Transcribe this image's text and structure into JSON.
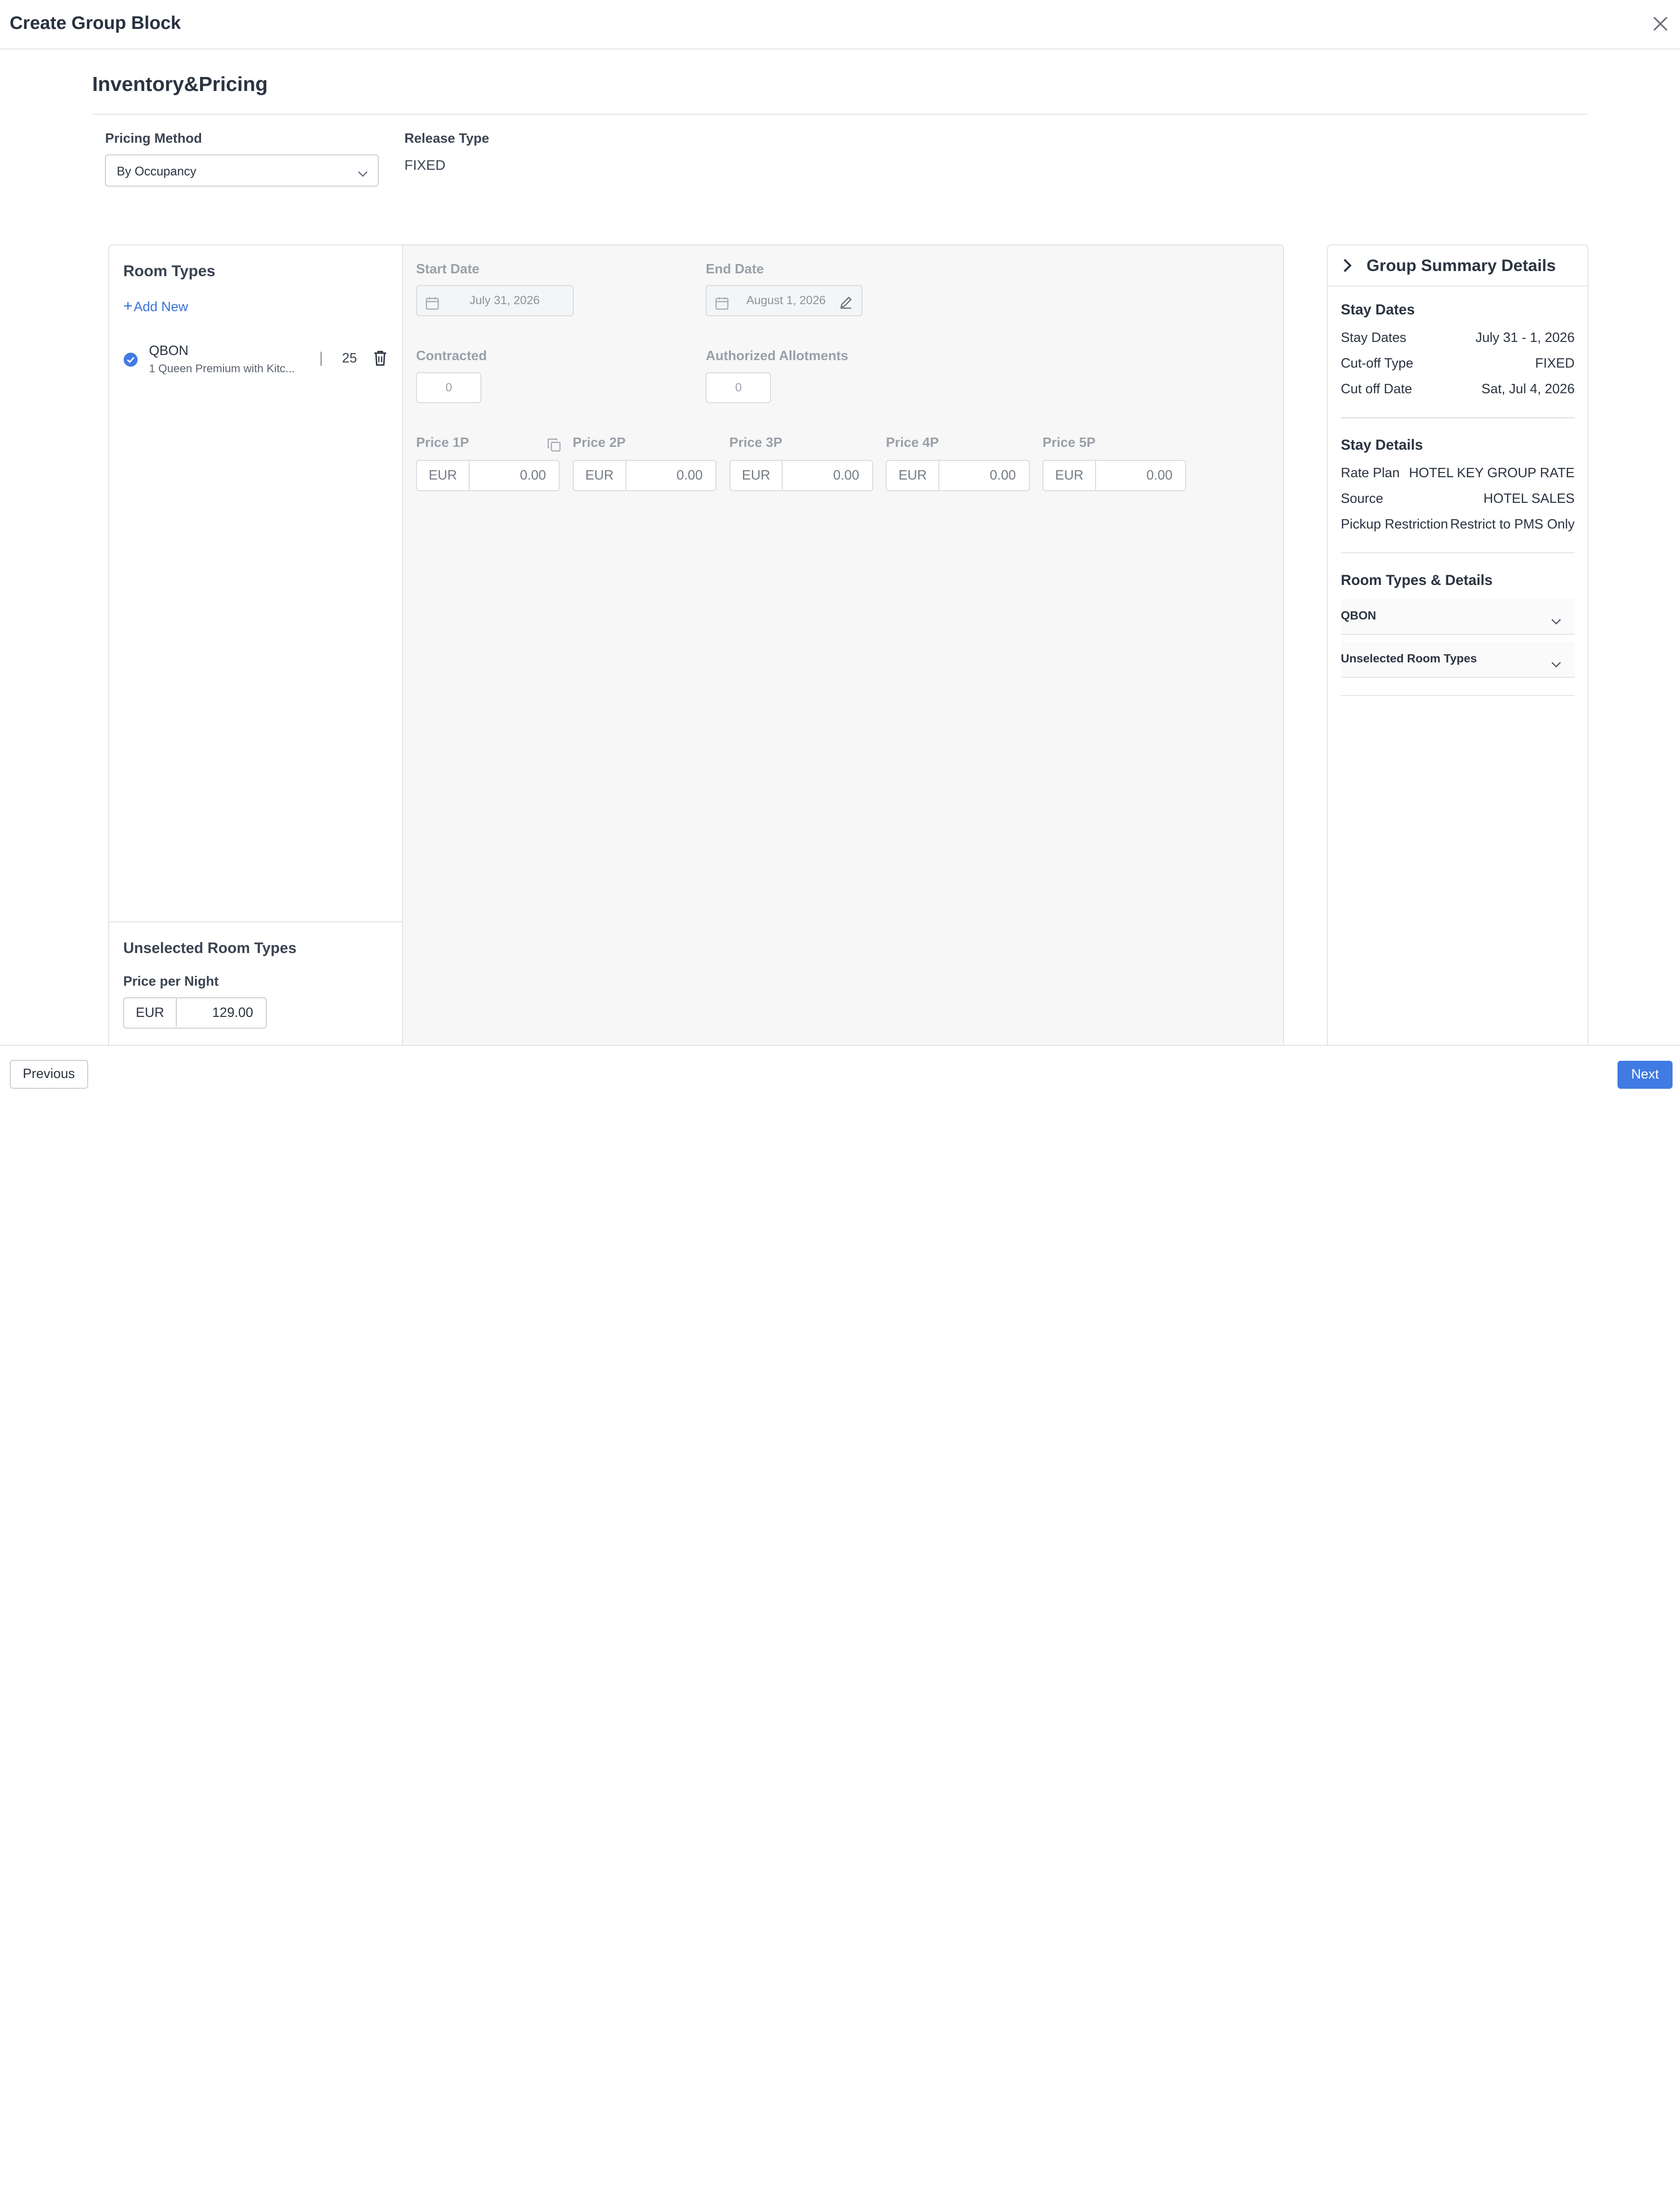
{
  "modal": {
    "title": "Create Group Block"
  },
  "section": {
    "title": "Inventory&Pricing"
  },
  "pricing_method": {
    "label": "Pricing Method",
    "value": "By Occupancy"
  },
  "release_type": {
    "label": "Release Type",
    "value": "FIXED"
  },
  "room_types": {
    "title": "Room Types",
    "add_new": "Add New",
    "items": [
      {
        "code": "QBON",
        "description": "1 Queen Premium with Kitc...",
        "count": "25"
      }
    ]
  },
  "unselected": {
    "title": "Unselected Room Types",
    "price_label": "Price per Night",
    "currency": "EUR",
    "amount": "129.00"
  },
  "details": {
    "start_date_label": "Start Date",
    "start_date": "July 31, 2026",
    "end_date_label": "End Date",
    "end_date": "August 1, 2026",
    "contracted_label": "Contracted",
    "contracted": "0",
    "allotments_label": "Authorized Allotments",
    "allotments": "0",
    "prices": [
      {
        "label": "Price 1P",
        "currency": "EUR",
        "amount": "0.00"
      },
      {
        "label": "Price 2P",
        "currency": "EUR",
        "amount": "0.00"
      },
      {
        "label": "Price 3P",
        "currency": "EUR",
        "amount": "0.00"
      },
      {
        "label": "Price 4P",
        "currency": "EUR",
        "amount": "0.00"
      },
      {
        "label": "Price 5P",
        "currency": "EUR",
        "amount": "0.00"
      }
    ]
  },
  "summary": {
    "title": "Group Summary Details",
    "stay_dates_title": "Stay Dates",
    "stay_dates": [
      {
        "key": "Stay Dates",
        "value": "July 31 - 1, 2026"
      },
      {
        "key": "Cut-off Type",
        "value": "FIXED"
      },
      {
        "key": "Cut off Date",
        "value": "Sat, Jul 4, 2026"
      }
    ],
    "stay_details_title": "Stay Details",
    "stay_details": [
      {
        "key": "Rate Plan",
        "value": "HOTEL KEY GROUP RATE"
      },
      {
        "key": "Source",
        "value": "HOTEL SALES"
      },
      {
        "key": "Pickup Restriction",
        "value": "Restrict to PMS Only"
      }
    ],
    "room_types_title": "Room Types & Details",
    "accordions": [
      "QBON",
      "Unselected Room Types"
    ]
  },
  "footer": {
    "previous": "Previous",
    "next": "Next"
  },
  "colors": {
    "accent": "#3f7be3",
    "link": "#3a73d9",
    "border": "#dfe3e8",
    "panel_bg": "#f7f7f8"
  }
}
